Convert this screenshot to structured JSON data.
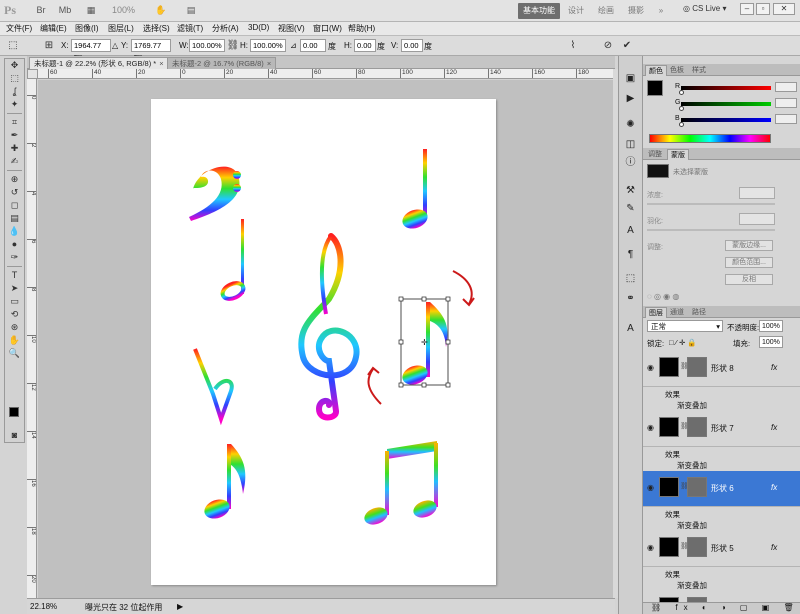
{
  "app": {
    "logo": "Ps",
    "zoom_display": "100%",
    "cs_live": "CS Live"
  },
  "workspaces": [
    {
      "label": "基本功能",
      "active": true
    },
    {
      "label": "设计",
      "active": false
    },
    {
      "label": "绘画",
      "active": false
    },
    {
      "label": "摄影",
      "active": false
    },
    {
      "label": "»",
      "active": false
    }
  ],
  "menus": [
    "文件(F)",
    "编辑(E)",
    "图像(I)",
    "图层(L)",
    "选择(S)",
    "滤镜(T)",
    "分析(A)",
    "3D(D)",
    "视图(V)",
    "窗口(W)",
    "帮助(H)"
  ],
  "options": {
    "x_label": "X:",
    "x_value": "1964.77 px",
    "y_label": "Y:",
    "y_value": "1769.77 px",
    "w_label": "W:",
    "w_value": "100.00%",
    "h_label": "H:",
    "h_value": "100.00%",
    "angle_value": "0.00",
    "hskew_label": "H:",
    "hskew_value": "0.00",
    "vskew_label": "V:",
    "vskew_value": "0.00",
    "angle_suffix": "度",
    "hskew_suffix": "度",
    "vskew_suffix": "度"
  },
  "tabs": [
    {
      "label": "未标题-1 @ 22.2% (形状 6, RGB/8) *",
      "active": true
    },
    {
      "label": "未标题-2 @ 16.7% (RGB/8)",
      "active": false
    }
  ],
  "ruler_ticks": [
    "60",
    "40",
    "20",
    "0",
    "20",
    "40",
    "60",
    "80",
    "100",
    "120",
    "140",
    "160",
    "180",
    "200"
  ],
  "vruler_ticks": [
    "0",
    "2",
    "4",
    "6",
    "8",
    "10",
    "12",
    "14",
    "16",
    "18",
    "20"
  ],
  "status": {
    "zoom": "22.18%",
    "message": "曝光只在 32 位起作用"
  },
  "color_panel": {
    "tabs": [
      "颜色",
      "色板",
      "样式"
    ],
    "channel_labels": [
      "R",
      "G",
      "B"
    ]
  },
  "adjust_panel": {
    "tabs": [
      "调整",
      "蒙版"
    ],
    "no_mask": "未选择蒙版",
    "density_label": "浓度:",
    "feather_label": "羽化:",
    "refine_label": "调整:",
    "buttons": [
      "蒙版边缘...",
      "颜色范围...",
      "反相"
    ]
  },
  "layers_panel": {
    "tabs": [
      "图层",
      "通道",
      "路径"
    ],
    "blend_mode": "正常",
    "opacity_label": "不透明度:",
    "opacity_value": "100%",
    "lock_label": "锁定:",
    "fill_label": "填充:",
    "fill_value": "100%",
    "layers": [
      {
        "name": "形状 8",
        "fx": "fx",
        "effects": "效果",
        "overlay": "渐变叠加",
        "selected": false
      },
      {
        "name": "形状 7",
        "fx": "fx",
        "effects": "效果",
        "overlay": "渐变叠加",
        "selected": false
      },
      {
        "name": "形状 6",
        "fx": "fx",
        "effects": "效果",
        "overlay": "渐变叠加",
        "selected": true
      },
      {
        "name": "形状 5",
        "fx": "fx",
        "effects": "效果",
        "overlay": "渐变叠加",
        "selected": false
      },
      {
        "name": "形状 4",
        "fx": "fx",
        "effects": "效果",
        "overlay": "",
        "selected": false
      }
    ]
  },
  "colors": {
    "accent": "#3b78d4",
    "selection": "#4a90e2",
    "arrow": "#cc1a1a"
  },
  "icons": [
    "move-icon",
    "marquee-icon",
    "lasso-icon",
    "magic-wand-icon",
    "crop-icon",
    "eyedropper-icon",
    "healing-brush-icon",
    "brush-icon",
    "clone-stamp-icon",
    "history-brush-icon",
    "eraser-icon",
    "gradient-icon",
    "blur-icon",
    "dodge-icon",
    "pen-icon",
    "type-icon",
    "path-select-icon",
    "shape-icon",
    "3d-rotate-icon",
    "3d-orbit-icon",
    "hand-icon",
    "zoom-icon"
  ],
  "note_shapes": [
    "bass-clef",
    "quarter-note-upper",
    "half-note",
    "treble-clef",
    "eighth-note-selected",
    "flat-sign",
    "eighth-note-lower",
    "beamed-notes"
  ]
}
